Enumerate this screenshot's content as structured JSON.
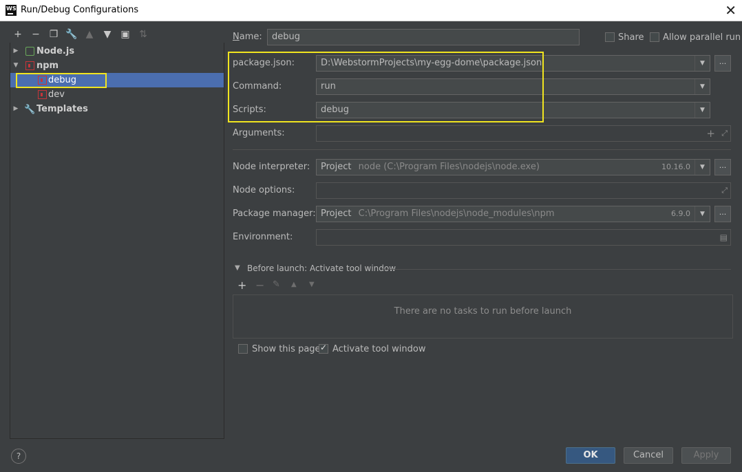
{
  "window": {
    "app_icon_text": "WS",
    "title": "Run/Debug Configurations",
    "close_glyph": "✕"
  },
  "toolbar": {
    "icons": [
      "add-icon",
      "remove-icon",
      "copy-icon",
      "wrench-icon",
      "move-up-icon",
      "move-down-icon",
      "new-folder-icon",
      "sort-icon"
    ]
  },
  "tree": {
    "nodejs": "Node.js",
    "npm": "npm",
    "debug": "debug",
    "dev": "dev",
    "templates": "Templates"
  },
  "form": {
    "name_label": "Name:",
    "name_value": "debug",
    "share_label": "Share",
    "parallel_label": "Allow parallel run",
    "package_json_label": "package.json:",
    "package_json_value": "D:\\WebstormProjects\\my-egg-dome\\package.json",
    "command_label": "Command:",
    "command_value": "run",
    "scripts_label": "Scripts:",
    "scripts_value": "debug",
    "arguments_label": "Arguments:",
    "node_interpreter_label": "Node interpreter:",
    "node_interpreter_prefix": "Project",
    "node_interpreter_value": "node (C:\\Program Files\\nodejs\\node.exe)",
    "node_interpreter_version": "10.16.0",
    "node_options_label": "Node options:",
    "package_manager_label": "Package manager:",
    "package_manager_prefix": "Project",
    "package_manager_value": "C:\\Program Files\\nodejs\\node_modules\\npm",
    "package_manager_version": "6.9.0",
    "environment_label": "Environment:",
    "dots": "..."
  },
  "before_launch": {
    "header": "Before launch: Activate tool window",
    "empty_text": "There are no tasks to run before launch",
    "show_page_label": "Show this page",
    "activate_label": "Activate tool window"
  },
  "buttons": {
    "ok": "OK",
    "cancel": "Cancel",
    "apply": "Apply",
    "help": "?"
  },
  "colors": {
    "background": "#3c3f41",
    "selection": "#4b6eaf",
    "highlight": "#f1e51f",
    "primary_button": "#365880"
  }
}
